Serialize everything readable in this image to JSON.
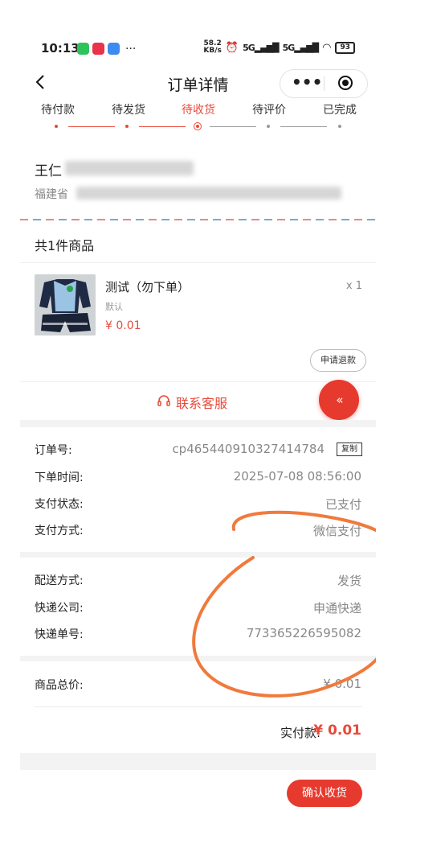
{
  "status_bar": {
    "time": "10:13",
    "dots": "···",
    "net_speed_value": "58.2",
    "net_speed_unit": "KB/s",
    "signal1": "5G",
    "signal2": "5G",
    "battery": "93"
  },
  "nav": {
    "title": "订单详情",
    "more": "•••"
  },
  "tabs": [
    {
      "label": "待付款"
    },
    {
      "label": "待发货"
    },
    {
      "label": "待收货"
    },
    {
      "label": "待评价"
    },
    {
      "label": "已完成"
    }
  ],
  "active_tab": 2,
  "address": {
    "name_visible": "王仁",
    "line_visible": "福建省"
  },
  "goods": {
    "count_label": "共1件商品",
    "items": [
      {
        "name": "测试（勿下单）",
        "spec": "默认",
        "price": "¥ 0.01",
        "qty": "x 1"
      }
    ],
    "refund_label": "申请退款",
    "customer_service_label": "联系客服",
    "fab_icon": "«"
  },
  "order_info": [
    {
      "label": "订单号:",
      "value": "cp465440910327414784"
    },
    {
      "label": "下单时间:",
      "value": "2025-07-08 08:56:00"
    },
    {
      "label": "支付状态:",
      "value": "已支付"
    },
    {
      "label": "支付方式:",
      "value": "微信支付"
    }
  ],
  "copy_label": "复制",
  "shipping_info": [
    {
      "label": "配送方式:",
      "value": "发货"
    },
    {
      "label": "快递公司:",
      "value": "申通快递"
    },
    {
      "label": "快递单号:",
      "value": "773365226595082"
    }
  ],
  "totals": {
    "goods_total_label": "商品总价:",
    "goods_total_value": "¥ 0.01",
    "paid_label": "实付款:",
    "paid_value": "¥ 0.01"
  },
  "confirm_label": "确认收货",
  "colors": {
    "accent": "#e74a3a",
    "button": "#e73a2e",
    "scribble": "#f07a3c"
  }
}
